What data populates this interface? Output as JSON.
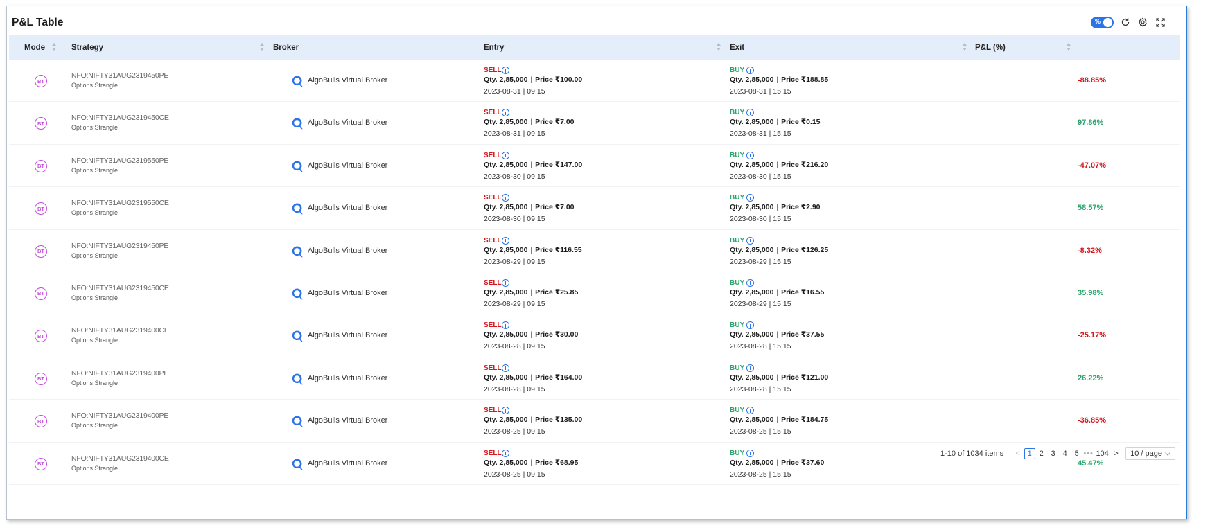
{
  "title": "P&L Table",
  "toolbar": {
    "toggle_label": "%"
  },
  "columns": {
    "mode": "Mode",
    "strategy": "Strategy",
    "broker": "Broker",
    "entry": "Entry",
    "exit": "Exit",
    "pnl": "P&L (%)"
  },
  "colors": {
    "sell": "#d4141a",
    "buy": "#2aa36b",
    "accent": "#2b73e6",
    "mode_badge": "#c44cdd",
    "header_bg": "#e4eefb"
  },
  "icons": {
    "mode": "bt-badge-icon",
    "broker": "algobulls-logo-icon",
    "info": "info-icon",
    "refresh": "refresh-icon",
    "settings": "gear-icon",
    "fullscreen": "fullscreen-icon"
  },
  "rows": [
    {
      "mode": "BT",
      "instrument": "NFO:NIFTY31AUG2319450PE",
      "strategy": "Options Strangle",
      "broker": "AlgoBulls Virtual Broker",
      "entry": {
        "side": "SELL",
        "qty": "Qty. 2,85,000",
        "price": "Price ₹100.00",
        "datetime": "2023-08-31 | 09:15"
      },
      "exit": {
        "side": "BUY",
        "qty": "Qty. 2,85,000",
        "price": "Price ₹188.85",
        "datetime": "2023-08-31 | 15:15"
      },
      "pnl": "-88.85%",
      "pnl_sign": "neg"
    },
    {
      "mode": "BT",
      "instrument": "NFO:NIFTY31AUG2319450CE",
      "strategy": "Options Strangle",
      "broker": "AlgoBulls Virtual Broker",
      "entry": {
        "side": "SELL",
        "qty": "Qty. 2,85,000",
        "price": "Price ₹7.00",
        "datetime": "2023-08-31 | 09:15"
      },
      "exit": {
        "side": "BUY",
        "qty": "Qty. 2,85,000",
        "price": "Price ₹0.15",
        "datetime": "2023-08-31 | 15:15"
      },
      "pnl": "97.86%",
      "pnl_sign": "pos"
    },
    {
      "mode": "BT",
      "instrument": "NFO:NIFTY31AUG2319550PE",
      "strategy": "Options Strangle",
      "broker": "AlgoBulls Virtual Broker",
      "entry": {
        "side": "SELL",
        "qty": "Qty. 2,85,000",
        "price": "Price ₹147.00",
        "datetime": "2023-08-30 | 09:15"
      },
      "exit": {
        "side": "BUY",
        "qty": "Qty. 2,85,000",
        "price": "Price ₹216.20",
        "datetime": "2023-08-30 | 15:15"
      },
      "pnl": "-47.07%",
      "pnl_sign": "neg"
    },
    {
      "mode": "BT",
      "instrument": "NFO:NIFTY31AUG2319550CE",
      "strategy": "Options Strangle",
      "broker": "AlgoBulls Virtual Broker",
      "entry": {
        "side": "SELL",
        "qty": "Qty. 2,85,000",
        "price": "Price ₹7.00",
        "datetime": "2023-08-30 | 09:15"
      },
      "exit": {
        "side": "BUY",
        "qty": "Qty. 2,85,000",
        "price": "Price ₹2.90",
        "datetime": "2023-08-30 | 15:15"
      },
      "pnl": "58.57%",
      "pnl_sign": "pos"
    },
    {
      "mode": "BT",
      "instrument": "NFO:NIFTY31AUG2319450PE",
      "strategy": "Options Strangle",
      "broker": "AlgoBulls Virtual Broker",
      "entry": {
        "side": "SELL",
        "qty": "Qty. 2,85,000",
        "price": "Price ₹116.55",
        "datetime": "2023-08-29 | 09:15"
      },
      "exit": {
        "side": "BUY",
        "qty": "Qty. 2,85,000",
        "price": "Price ₹126.25",
        "datetime": "2023-08-29 | 15:15"
      },
      "pnl": "-8.32%",
      "pnl_sign": "neg"
    },
    {
      "mode": "BT",
      "instrument": "NFO:NIFTY31AUG2319450CE",
      "strategy": "Options Strangle",
      "broker": "AlgoBulls Virtual Broker",
      "entry": {
        "side": "SELL",
        "qty": "Qty. 2,85,000",
        "price": "Price ₹25.85",
        "datetime": "2023-08-29 | 09:15"
      },
      "exit": {
        "side": "BUY",
        "qty": "Qty. 2,85,000",
        "price": "Price ₹16.55",
        "datetime": "2023-08-29 | 15:15"
      },
      "pnl": "35.98%",
      "pnl_sign": "pos"
    },
    {
      "mode": "BT",
      "instrument": "NFO:NIFTY31AUG2319400CE",
      "strategy": "Options Strangle",
      "broker": "AlgoBulls Virtual Broker",
      "entry": {
        "side": "SELL",
        "qty": "Qty. 2,85,000",
        "price": "Price ₹30.00",
        "datetime": "2023-08-28 | 09:15"
      },
      "exit": {
        "side": "BUY",
        "qty": "Qty. 2,85,000",
        "price": "Price ₹37.55",
        "datetime": "2023-08-28 | 15:15"
      },
      "pnl": "-25.17%",
      "pnl_sign": "neg"
    },
    {
      "mode": "BT",
      "instrument": "NFO:NIFTY31AUG2319400PE",
      "strategy": "Options Strangle",
      "broker": "AlgoBulls Virtual Broker",
      "entry": {
        "side": "SELL",
        "qty": "Qty. 2,85,000",
        "price": "Price ₹164.00",
        "datetime": "2023-08-28 | 09:15"
      },
      "exit": {
        "side": "BUY",
        "qty": "Qty. 2,85,000",
        "price": "Price ₹121.00",
        "datetime": "2023-08-28 | 15:15"
      },
      "pnl": "26.22%",
      "pnl_sign": "pos"
    },
    {
      "mode": "BT",
      "instrument": "NFO:NIFTY31AUG2319400PE",
      "strategy": "Options Strangle",
      "broker": "AlgoBulls Virtual Broker",
      "entry": {
        "side": "SELL",
        "qty": "Qty. 2,85,000",
        "price": "Price ₹135.00",
        "datetime": "2023-08-25 | 09:15"
      },
      "exit": {
        "side": "BUY",
        "qty": "Qty. 2,85,000",
        "price": "Price ₹184.75",
        "datetime": "2023-08-25 | 15:15"
      },
      "pnl": "-36.85%",
      "pnl_sign": "neg"
    },
    {
      "mode": "BT",
      "instrument": "NFO:NIFTY31AUG2319400CE",
      "strategy": "Options Strangle",
      "broker": "AlgoBulls Virtual Broker",
      "entry": {
        "side": "SELL",
        "qty": "Qty. 2,85,000",
        "price": "Price ₹68.95",
        "datetime": "2023-08-25 | 09:15"
      },
      "exit": {
        "side": "BUY",
        "qty": "Qty. 2,85,000",
        "price": "Price ₹37.60",
        "datetime": "2023-08-25 | 15:15"
      },
      "pnl": "45.47%",
      "pnl_sign": "pos"
    }
  ],
  "pagination": {
    "total_text": "1-10 of 1034 items",
    "prev": "<",
    "pages": [
      "1",
      "2",
      "3",
      "4",
      "5"
    ],
    "current": "1",
    "ellipsis": "•••",
    "last": "104",
    "next": ">",
    "page_size": "10 / page"
  }
}
